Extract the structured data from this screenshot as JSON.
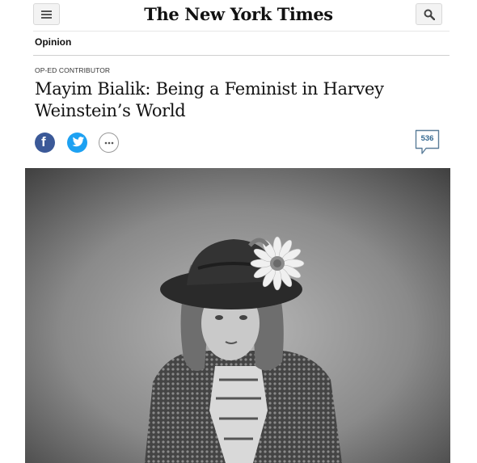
{
  "header": {
    "masthead": "The New York Times",
    "menu_icon": "hamburger-menu-icon",
    "search_icon": "search-icon"
  },
  "section": {
    "label": "Opinion"
  },
  "article": {
    "kicker": "OP-ED CONTRIBUTOR",
    "headline": "Mayim Bialik: Being a Feminist in Harvey Weinstein’s World",
    "share": {
      "facebook_glyph": "f",
      "facebook_icon": "facebook-icon",
      "twitter_icon": "twitter-bird-icon",
      "more_icon": "ellipsis-icon"
    },
    "comments": {
      "count": "536",
      "icon": "comment-bubble-icon"
    }
  },
  "colors": {
    "facebook": "#3b5998",
    "twitter": "#1da1f2",
    "comment_accent": "#326891"
  }
}
